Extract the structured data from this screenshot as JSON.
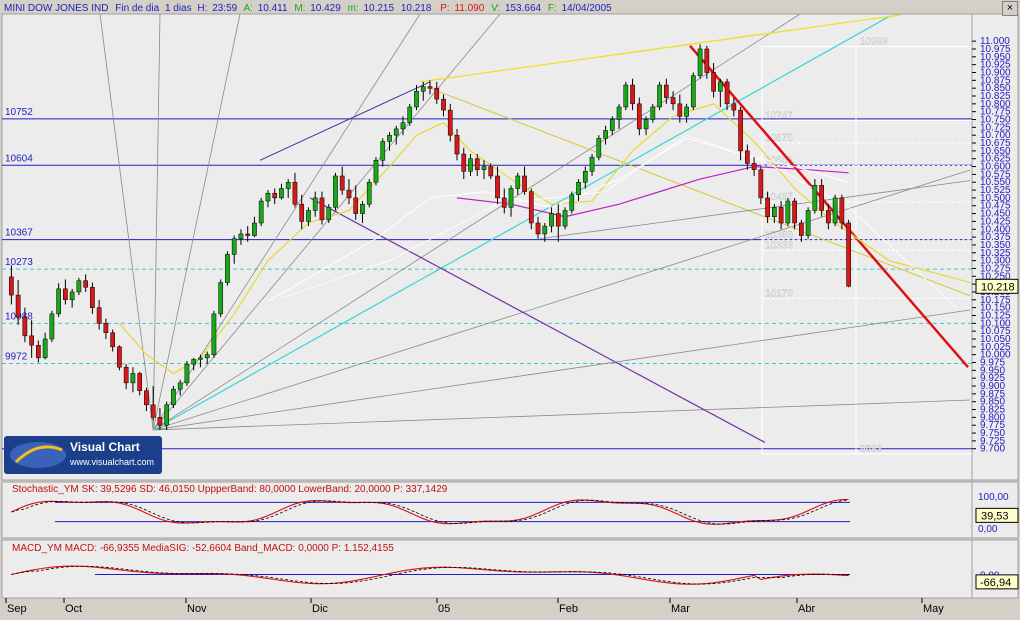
{
  "header": {
    "symbol": "MINI DOW JONES IND",
    "session": "Fin de dia",
    "period": "1 dias",
    "h_label": "H:",
    "time": "23:59",
    "a_label": "A:",
    "open": "10.411",
    "m_label": "M:",
    "high": "10.429",
    "m2_label": "m:",
    "low": "10.215",
    "close": "10.218",
    "p_label": "P:",
    "points": "11.090",
    "v_label": "V:",
    "volume": "153.664",
    "f_label": "F:",
    "date": "14/04/2005"
  },
  "logo": {
    "name": "Visual Chart",
    "url": "www.visualchart.com"
  },
  "colors": {
    "background": "#ececec",
    "up": "#18a818",
    "down": "#d81818",
    "blue_line": "#2020c0",
    "red_trend": "#e01010",
    "yellow": "#f0e020",
    "cyan": "#40d8d8",
    "magenta": "#c020c0",
    "purple": "#7030a0"
  },
  "chart_data": [
    {
      "type": "candlestick",
      "ylim": [
        9680,
        11010
      ],
      "y_ticks": [
        "11.000",
        "10.975",
        "10.950",
        "10.925",
        "10.900",
        "10.875",
        "10.850",
        "10.825",
        "10.800",
        "10.775",
        "10.750",
        "10.725",
        "10.700",
        "10.675",
        "10.650",
        "10.625",
        "10.600",
        "10.575",
        "10.550",
        "10.525",
        "10.500",
        "10.475",
        "10.450",
        "10.425",
        "10.400",
        "10.375",
        "10.350",
        "10.325",
        "10.300",
        "10.275",
        "10.250",
        "10.225",
        "10.200",
        "10.175",
        "10.150",
        "10.125",
        "10.100",
        "10.075",
        "10.050",
        "10.025",
        "10.000",
        "9.975",
        "9.950",
        "9.925",
        "9.900",
        "9.875",
        "9.850",
        "9.825",
        "9.800",
        "9.775",
        "9.750",
        "9.725",
        "9.700"
      ],
      "x_ticks": [
        "Sep",
        "Oct",
        "Nov",
        "Dic",
        "05",
        "Feb",
        "Mar",
        "Abr",
        "May"
      ],
      "last_value": "10.218",
      "levels_left": [
        {
          "label": "10752",
          "value": 10752,
          "style": "solid",
          "color": "#2020c0"
        },
        {
          "label": "10604",
          "value": 10604,
          "style": "solid",
          "color": "#2020c0"
        },
        {
          "label": "10367",
          "value": 10367,
          "style": "solid",
          "color": "#2020c0"
        },
        {
          "label": "10273",
          "value": 10273,
          "style": "dash",
          "color": "#40c8c8"
        },
        {
          "label": "10088",
          "value": 10100,
          "style": "dash",
          "color": "#40c8c8"
        },
        {
          "label": "9972",
          "value": 9972,
          "style": "dash",
          "color": "#40c8c8"
        },
        {
          "label": "9",
          "value": 9700,
          "style": "solid",
          "color": "#2020c0"
        }
      ],
      "levels_right": [
        {
          "label": "10983",
          "value": 10983,
          "style": "solid"
        },
        {
          "label": "10747",
          "value": 10747,
          "style": "solid"
        },
        {
          "label": "10675",
          "value": 10675,
          "style": "dash"
        },
        {
          "label": "10603",
          "value": 10603,
          "style": "dash"
        },
        {
          "label": "10487",
          "value": 10487,
          "style": "dash"
        },
        {
          "label": "10366",
          "value": 10366,
          "style": "dash"
        },
        {
          "label": "10333",
          "value": 10333,
          "style": "dash"
        },
        {
          "label": "10179",
          "value": 10179,
          "style": "dash"
        },
        {
          "label": "9683",
          "value": 9683,
          "style": "solid"
        }
      ],
      "candles": [
        [
          10248,
          10285,
          10160,
          10190
        ],
        [
          10190,
          10238,
          10095,
          10120
        ],
        [
          10120,
          10150,
          10040,
          10060
        ],
        [
          10060,
          10110,
          9990,
          10030
        ],
        [
          10030,
          10045,
          9975,
          9990
        ],
        [
          9990,
          10070,
          9985,
          10050
        ],
        [
          10050,
          10140,
          10040,
          10130
        ],
        [
          10130,
          10228,
          10120,
          10210
        ],
        [
          10210,
          10240,
          10160,
          10175
        ],
        [
          10175,
          10210,
          10150,
          10200
        ],
        [
          10200,
          10245,
          10190,
          10236
        ],
        [
          10236,
          10256,
          10200,
          10215
        ],
        [
          10215,
          10230,
          10130,
          10150
        ],
        [
          10150,
          10175,
          10080,
          10100
        ],
        [
          10100,
          10115,
          10050,
          10070
        ],
        [
          10070,
          10080,
          10010,
          10025
        ],
        [
          10025,
          10030,
          9950,
          9960
        ],
        [
          9960,
          9970,
          9890,
          9910
        ],
        [
          9910,
          9960,
          9880,
          9940
        ],
        [
          9940,
          9945,
          9870,
          9885
        ],
        [
          9885,
          9895,
          9820,
          9840
        ],
        [
          9840,
          9900,
          9790,
          9800
        ],
        [
          9800,
          9830,
          9760,
          9775
        ],
        [
          9775,
          9850,
          9760,
          9840
        ],
        [
          9840,
          9900,
          9830,
          9890
        ],
        [
          9890,
          9920,
          9870,
          9910
        ],
        [
          9910,
          9980,
          9900,
          9970
        ],
        [
          9970,
          9990,
          9950,
          9985
        ],
        [
          9985,
          10000,
          9960,
          9990
        ],
        [
          9990,
          10010,
          9970,
          10000
        ],
        [
          10000,
          10140,
          9990,
          10130
        ],
        [
          10130,
          10240,
          10120,
          10230
        ],
        [
          10230,
          10330,
          10220,
          10320
        ],
        [
          10320,
          10380,
          10290,
          10370
        ],
        [
          10370,
          10400,
          10350,
          10385
        ],
        [
          10385,
          10410,
          10360,
          10380
        ],
        [
          10380,
          10440,
          10375,
          10420
        ],
        [
          10420,
          10500,
          10410,
          10490
        ],
        [
          10490,
          10525,
          10470,
          10515
        ],
        [
          10515,
          10530,
          10480,
          10500
        ],
        [
          10500,
          10545,
          10495,
          10530
        ],
        [
          10530,
          10560,
          10500,
          10550
        ],
        [
          10550,
          10580,
          10470,
          10480
        ],
        [
          10480,
          10510,
          10400,
          10425
        ],
        [
          10425,
          10470,
          10410,
          10460
        ],
        [
          10460,
          10520,
          10440,
          10500
        ],
        [
          10500,
          10520,
          10415,
          10430
        ],
        [
          10430,
          10480,
          10420,
          10470
        ],
        [
          10470,
          10580,
          10460,
          10570
        ],
        [
          10570,
          10600,
          10510,
          10525
        ],
        [
          10525,
          10560,
          10480,
          10500
        ],
        [
          10500,
          10540,
          10430,
          10450
        ],
        [
          10450,
          10490,
          10420,
          10480
        ],
        [
          10480,
          10560,
          10470,
          10550
        ],
        [
          10550,
          10630,
          10540,
          10620
        ],
        [
          10620,
          10690,
          10600,
          10680
        ],
        [
          10680,
          10710,
          10650,
          10700
        ],
        [
          10700,
          10730,
          10670,
          10720
        ],
        [
          10720,
          10760,
          10700,
          10740
        ],
        [
          10740,
          10800,
          10730,
          10790
        ],
        [
          10790,
          10860,
          10780,
          10840
        ],
        [
          10840,
          10870,
          10810,
          10855
        ],
        [
          10855,
          10875,
          10830,
          10850
        ],
        [
          10850,
          10870,
          10800,
          10815
        ],
        [
          10815,
          10830,
          10760,
          10780
        ],
        [
          10780,
          10800,
          10680,
          10700
        ],
        [
          10700,
          10720,
          10620,
          10640
        ],
        [
          10640,
          10660,
          10560,
          10585
        ],
        [
          10585,
          10640,
          10570,
          10625
        ],
        [
          10625,
          10640,
          10570,
          10590
        ],
        [
          10590,
          10620,
          10560,
          10600
        ],
        [
          10600,
          10610,
          10560,
          10570
        ],
        [
          10570,
          10600,
          10480,
          10500
        ],
        [
          10500,
          10530,
          10450,
          10470
        ],
        [
          10470,
          10540,
          10440,
          10530
        ],
        [
          10530,
          10580,
          10510,
          10570
        ],
        [
          10570,
          10600,
          10510,
          10520
        ],
        [
          10520,
          10530,
          10400,
          10420
        ],
        [
          10420,
          10440,
          10370,
          10385
        ],
        [
          10385,
          10420,
          10360,
          10410
        ],
        [
          10410,
          10470,
          10390,
          10450
        ],
        [
          10450,
          10480,
          10360,
          10410
        ],
        [
          10410,
          10470,
          10400,
          10460
        ],
        [
          10460,
          10520,
          10450,
          10510
        ],
        [
          10510,
          10560,
          10490,
          10550
        ],
        [
          10550,
          10600,
          10530,
          10585
        ],
        [
          10585,
          10640,
          10570,
          10630
        ],
        [
          10630,
          10700,
          10620,
          10690
        ],
        [
          10690,
          10730,
          10670,
          10715
        ],
        [
          10715,
          10760,
          10700,
          10750
        ],
        [
          10750,
          10800,
          10720,
          10790
        ],
        [
          10790,
          10870,
          10780,
          10860
        ],
        [
          10860,
          10880,
          10780,
          10800
        ],
        [
          10800,
          10820,
          10700,
          10720
        ],
        [
          10720,
          10760,
          10700,
          10750
        ],
        [
          10750,
          10800,
          10740,
          10790
        ],
        [
          10790,
          10870,
          10780,
          10860
        ],
        [
          10860,
          10880,
          10800,
          10820
        ],
        [
          10820,
          10840,
          10780,
          10800
        ],
        [
          10800,
          10830,
          10740,
          10760
        ],
        [
          10760,
          10800,
          10740,
          10790
        ],
        [
          10790,
          10900,
          10780,
          10890
        ],
        [
          10890,
          10990,
          10880,
          10975
        ],
        [
          10975,
          10985,
          10880,
          10900
        ],
        [
          10900,
          10930,
          10820,
          10840
        ],
        [
          10840,
          10880,
          10790,
          10870
        ],
        [
          10870,
          10880,
          10780,
          10800
        ],
        [
          10800,
          10820,
          10760,
          10780
        ],
        [
          10780,
          10790,
          10620,
          10650
        ],
        [
          10650,
          10670,
          10590,
          10610
        ],
        [
          10610,
          10630,
          10570,
          10590
        ],
        [
          10590,
          10600,
          10480,
          10500
        ],
        [
          10500,
          10520,
          10420,
          10440
        ],
        [
          10440,
          10480,
          10420,
          10470
        ],
        [
          10470,
          10490,
          10400,
          10420
        ],
        [
          10420,
          10500,
          10410,
          10490
        ],
        [
          10490,
          10500,
          10400,
          10420
        ],
        [
          10420,
          10430,
          10360,
          10380
        ],
        [
          10380,
          10470,
          10370,
          10460
        ],
        [
          10460,
          10560,
          10450,
          10540
        ],
        [
          10540,
          10560,
          10440,
          10460
        ],
        [
          10460,
          10480,
          10400,
          10420
        ],
        [
          10420,
          10510,
          10410,
          10500
        ],
        [
          10500,
          10510,
          10400,
          10420
        ],
        [
          10420,
          10430,
          10215,
          10218
        ]
      ],
      "trendlines": [
        {
          "name": "red-trendline",
          "color": "#e01010"
        },
        {
          "name": "yellow-line",
          "color": "#f0e020"
        },
        {
          "name": "cyan-line",
          "color": "#40d8d8"
        },
        {
          "name": "purple-line",
          "color": "#7030a0"
        }
      ]
    },
    {
      "type": "line",
      "title": "Stochastic_YM",
      "legend": "Stochastic_YM  SK: 39,5296   SD: 46,0150   UppperBand: 80,0000   LowerBand: 20,0000   P: 337,1429",
      "ylim": [
        0,
        100
      ],
      "y_ticks": [
        "100,00",
        "50,00",
        "0,00"
      ],
      "bands": [
        80,
        20
      ],
      "last_value": "39,53"
    },
    {
      "type": "line",
      "title": "MACD_YM",
      "legend": "MACD_YM  MACD: -66,9355   MediaSIG: -52,6604   Band_MACD: 0,0000   P: 1.152,4155",
      "ylim": [
        -150,
        150
      ],
      "y_ticks": [
        "0,00"
      ],
      "last_value": "-66,94"
    }
  ]
}
